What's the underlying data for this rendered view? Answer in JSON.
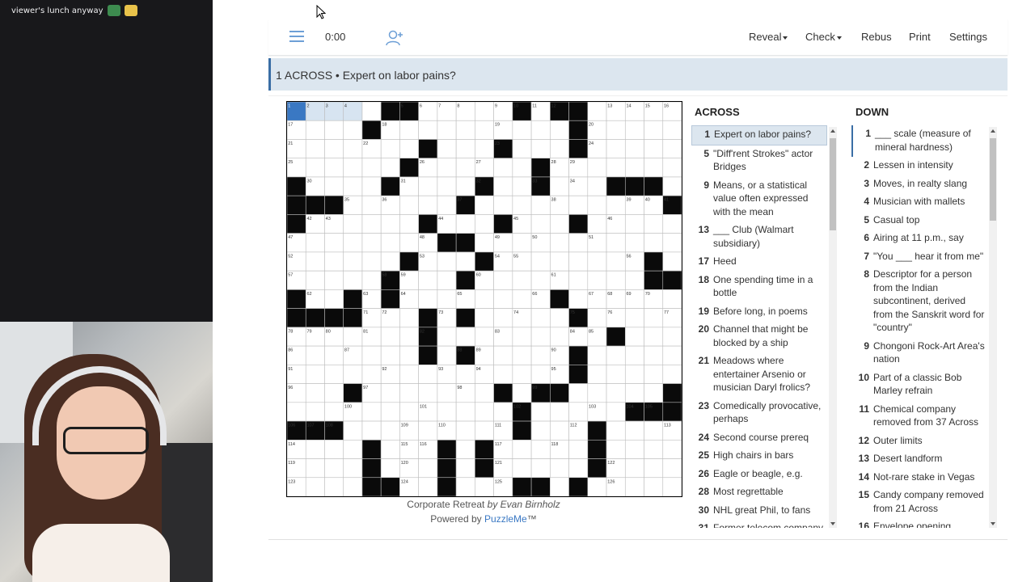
{
  "stream": {
    "chat_text": "viewer's lunch anyway",
    "emote_colors": [
      "#3d8b4f",
      "#e8c24a"
    ]
  },
  "toolbar": {
    "timer": "0:00",
    "reveal_label": "Reveal",
    "check_label": "Check",
    "rebus_label": "Rebus",
    "print_label": "Print",
    "settings_label": "Settings",
    "menu_icon": "hamburger-menu-icon",
    "add_user_icon": "add-user-icon",
    "accent_color": "#6d9fd6"
  },
  "clue_bar": {
    "text": "1 ACROSS • Expert on labor pains?"
  },
  "grid": {
    "size": 21,
    "selected_cell": [
      0,
      0
    ],
    "highlighted_cells": [
      [
        0,
        1
      ],
      [
        0,
        2
      ],
      [
        0,
        3
      ]
    ],
    "rows": [
      ".....##.....#.##.....",
      "....#..........#.....",
      ".......#...#...#.....",
      "......#......#.......",
      "#....#....#..#...###.",
      "###......#..........#",
      "#......#...#...#.....",
      "........##...........",
      "......#...#........#.",
      ".....#...#.........##",
      "#..#.#........#......",
      "####...#.#.....#.....",
      ".......#.........#...",
      ".......#.#.....#.....",
      "...............#.....",
      "...#.......#.##.....#",
      "............#.....###",
      "###.........#...#....",
      "....#...#.#.....#....",
      "....#...#.#.....#....",
      "....##..#...##.#....."
    ],
    "numbers": [
      [
        [
          0,
          0
        ],
        "1"
      ],
      [
        [
          0,
          1
        ],
        "2"
      ],
      [
        [
          0,
          2
        ],
        "3"
      ],
      [
        [
          0,
          3
        ],
        "4"
      ],
      [
        [
          0,
          6
        ],
        "5"
      ],
      [
        [
          0,
          7
        ],
        "6"
      ],
      [
        [
          0,
          8
        ],
        "7"
      ],
      [
        [
          0,
          9
        ],
        "8"
      ],
      [
        [
          0,
          11
        ],
        "9"
      ],
      [
        [
          0,
          12
        ],
        "10"
      ],
      [
        [
          0,
          13
        ],
        "11"
      ],
      [
        [
          0,
          14
        ],
        "12"
      ],
      [
        [
          0,
          17
        ],
        "13"
      ],
      [
        [
          0,
          18
        ],
        "14"
      ],
      [
        [
          0,
          19
        ],
        "15"
      ],
      [
        [
          0,
          20
        ],
        "16"
      ],
      [
        [
          1,
          0
        ],
        "17"
      ],
      [
        [
          1,
          5
        ],
        "18"
      ],
      [
        [
          1,
          11
        ],
        "19"
      ],
      [
        [
          1,
          16
        ],
        "20"
      ],
      [
        [
          2,
          0
        ],
        "21"
      ],
      [
        [
          2,
          4
        ],
        "22"
      ],
      [
        [
          2,
          11
        ],
        "23"
      ],
      [
        [
          2,
          16
        ],
        "24"
      ],
      [
        [
          3,
          0
        ],
        "25"
      ],
      [
        [
          3,
          7
        ],
        "26"
      ],
      [
        [
          3,
          10
        ],
        "27"
      ],
      [
        [
          3,
          14
        ],
        "28"
      ],
      [
        [
          3,
          15
        ],
        "29"
      ],
      [
        [
          4,
          1
        ],
        "30"
      ],
      [
        [
          4,
          6
        ],
        "31"
      ],
      [
        [
          4,
          10
        ],
        "32"
      ],
      [
        [
          4,
          13
        ],
        "33"
      ],
      [
        [
          4,
          15
        ],
        "34"
      ],
      [
        [
          5,
          3
        ],
        "35"
      ],
      [
        [
          5,
          5
        ],
        "36"
      ],
      [
        [
          5,
          9
        ],
        "37"
      ],
      [
        [
          5,
          14
        ],
        "38"
      ],
      [
        [
          5,
          18
        ],
        "39"
      ],
      [
        [
          5,
          19
        ],
        "40"
      ],
      [
        [
          5,
          20
        ],
        "41"
      ],
      [
        [
          6,
          1
        ],
        "42"
      ],
      [
        [
          6,
          2
        ],
        "43"
      ],
      [
        [
          6,
          8
        ],
        "44"
      ],
      [
        [
          6,
          12
        ],
        "45"
      ],
      [
        [
          6,
          17
        ],
        "46"
      ],
      [
        [
          7,
          0
        ],
        "47"
      ],
      [
        [
          7,
          7
        ],
        "48"
      ],
      [
        [
          7,
          11
        ],
        "49"
      ],
      [
        [
          7,
          13
        ],
        "50"
      ],
      [
        [
          7,
          16
        ],
        "51"
      ],
      [
        [
          8,
          0
        ],
        "52"
      ],
      [
        [
          8,
          7
        ],
        "53"
      ],
      [
        [
          8,
          11
        ],
        "54"
      ],
      [
        [
          8,
          12
        ],
        "55"
      ],
      [
        [
          8,
          18
        ],
        "56"
      ],
      [
        [
          9,
          0
        ],
        "57"
      ],
      [
        [
          9,
          5
        ],
        "58"
      ],
      [
        [
          9,
          6
        ],
        "59"
      ],
      [
        [
          9,
          10
        ],
        "60"
      ],
      [
        [
          9,
          14
        ],
        "61"
      ],
      [
        [
          10,
          1
        ],
        "62"
      ],
      [
        [
          10,
          4
        ],
        "63"
      ],
      [
        [
          10,
          6
        ],
        "64"
      ],
      [
        [
          10,
          9
        ],
        "65"
      ],
      [
        [
          10,
          13
        ],
        "66"
      ],
      [
        [
          10,
          16
        ],
        "67"
      ],
      [
        [
          10,
          17
        ],
        "68"
      ],
      [
        [
          10,
          18
        ],
        "69"
      ],
      [
        [
          10,
          19
        ],
        "70"
      ],
      [
        [
          11,
          4
        ],
        "71"
      ],
      [
        [
          11,
          5
        ],
        "72"
      ],
      [
        [
          11,
          8
        ],
        "73"
      ],
      [
        [
          11,
          12
        ],
        "74"
      ],
      [
        [
          11,
          15
        ],
        "75"
      ],
      [
        [
          11,
          17
        ],
        "76"
      ],
      [
        [
          11,
          20
        ],
        "77"
      ],
      [
        [
          12,
          0
        ],
        "78"
      ],
      [
        [
          12,
          1
        ],
        "79"
      ],
      [
        [
          12,
          2
        ],
        "80"
      ],
      [
        [
          12,
          4
        ],
        "81"
      ],
      [
        [
          12,
          7
        ],
        "82"
      ],
      [
        [
          12,
          11
        ],
        "83"
      ],
      [
        [
          12,
          15
        ],
        "84"
      ],
      [
        [
          12,
          16
        ],
        "85"
      ],
      [
        [
          13,
          0
        ],
        "86"
      ],
      [
        [
          13,
          3
        ],
        "87"
      ],
      [
        [
          13,
          9
        ],
        "88"
      ],
      [
        [
          13,
          10
        ],
        "89"
      ],
      [
        [
          13,
          14
        ],
        "90"
      ],
      [
        [
          14,
          0
        ],
        "91"
      ],
      [
        [
          14,
          5
        ],
        "92"
      ],
      [
        [
          14,
          8
        ],
        "93"
      ],
      [
        [
          14,
          10
        ],
        "94"
      ],
      [
        [
          14,
          14
        ],
        "95"
      ],
      [
        [
          15,
          0
        ],
        "96"
      ],
      [
        [
          15,
          4
        ],
        "97"
      ],
      [
        [
          15,
          9
        ],
        "98"
      ],
      [
        [
          15,
          13
        ],
        "99"
      ],
      [
        [
          16,
          3
        ],
        "100"
      ],
      [
        [
          16,
          7
        ],
        "101"
      ],
      [
        [
          16,
          12
        ],
        "102"
      ],
      [
        [
          16,
          16
        ],
        "103"
      ],
      [
        [
          16,
          18
        ],
        "104"
      ],
      [
        [
          16,
          19
        ],
        "105"
      ],
      [
        [
          17,
          0
        ],
        "106"
      ],
      [
        [
          17,
          1
        ],
        "107"
      ],
      [
        [
          17,
          2
        ],
        "108"
      ],
      [
        [
          17,
          6
        ],
        "109"
      ],
      [
        [
          17,
          8
        ],
        "110"
      ],
      [
        [
          17,
          11
        ],
        "111"
      ],
      [
        [
          17,
          15
        ],
        "112"
      ],
      [
        [
          17,
          20
        ],
        "113"
      ],
      [
        [
          18,
          0
        ],
        "114"
      ],
      [
        [
          18,
          6
        ],
        "115"
      ],
      [
        [
          18,
          7
        ],
        "116"
      ],
      [
        [
          18,
          11
        ],
        "117"
      ],
      [
        [
          18,
          14
        ],
        "118"
      ],
      [
        [
          19,
          0
        ],
        "119"
      ],
      [
        [
          19,
          6
        ],
        "120"
      ],
      [
        [
          19,
          11
        ],
        "121"
      ],
      [
        [
          19,
          17
        ],
        "122"
      ],
      [
        [
          20,
          0
        ],
        "123"
      ],
      [
        [
          20,
          6
        ],
        "124"
      ],
      [
        [
          20,
          11
        ],
        "125"
      ],
      [
        [
          20,
          17
        ],
        "126"
      ]
    ],
    "colors": {
      "block": "#0a0a0a",
      "selected": "#3a78c3",
      "highlight": "#d7e4f1",
      "line": "#bdbdbd"
    }
  },
  "credit": {
    "title": "Corporate Retreat",
    "by": "by Evan Birnholz",
    "powered_prefix": "Powered by",
    "powered_link": "PuzzleMe",
    "powered_suffix": "™"
  },
  "across": {
    "title": "ACROSS",
    "clues": [
      {
        "num": "1",
        "text": "Expert on labor pains?",
        "active": true
      },
      {
        "num": "5",
        "text": "\"Diff'rent Strokes\" actor Bridges"
      },
      {
        "num": "9",
        "text": "Means, or a statistical value often expressed with the mean"
      },
      {
        "num": "13",
        "text": "___ Club (Walmart subsidiary)"
      },
      {
        "num": "17",
        "text": "Heed"
      },
      {
        "num": "18",
        "text": "One spending time in a bottle"
      },
      {
        "num": "19",
        "text": "Before long, in poems"
      },
      {
        "num": "20",
        "text": "Channel that might be blocked by a ship"
      },
      {
        "num": "21",
        "text": "Meadows where entertainer Arsenio or musician Daryl frolics?"
      },
      {
        "num": "23",
        "text": "Comedically provocative, perhaps"
      },
      {
        "num": "24",
        "text": "Second course prereq"
      },
      {
        "num": "25",
        "text": "High chairs in bars"
      },
      {
        "num": "26",
        "text": "Eagle or beagle, e.g."
      },
      {
        "num": "28",
        "text": "Most regrettable"
      },
      {
        "num": "30",
        "text": "NHL great Phil, to fans"
      },
      {
        "num": "31",
        "text": "Former telecom company"
      }
    ]
  },
  "down": {
    "title": "DOWN",
    "clues": [
      {
        "num": "1",
        "text": "___ scale (measure of mineral hardness)",
        "cross": true
      },
      {
        "num": "2",
        "text": "Lessen in intensity"
      },
      {
        "num": "3",
        "text": "Moves, in realty slang"
      },
      {
        "num": "4",
        "text": "Musician with mallets"
      },
      {
        "num": "5",
        "text": "Casual top"
      },
      {
        "num": "6",
        "text": "Airing at 11 p.m., say"
      },
      {
        "num": "7",
        "text": "\"You ___ hear it from me\""
      },
      {
        "num": "8",
        "text": "Descriptor for a person from the Indian subcontinent, derived from the Sanskrit word for \"country\""
      },
      {
        "num": "9",
        "text": "Chongoni Rock-Art Area's nation"
      },
      {
        "num": "10",
        "text": "Part of a classic Bob Marley refrain"
      },
      {
        "num": "11",
        "text": "Chemical company removed from 37 Across"
      },
      {
        "num": "12",
        "text": "Outer limits"
      },
      {
        "num": "13",
        "text": "Desert landform"
      },
      {
        "num": "14",
        "text": "Not-rare stake in Vegas"
      },
      {
        "num": "15",
        "text": "Candy company removed from 21 Across"
      },
      {
        "num": "16",
        "text": "Envelope opening"
      }
    ]
  }
}
